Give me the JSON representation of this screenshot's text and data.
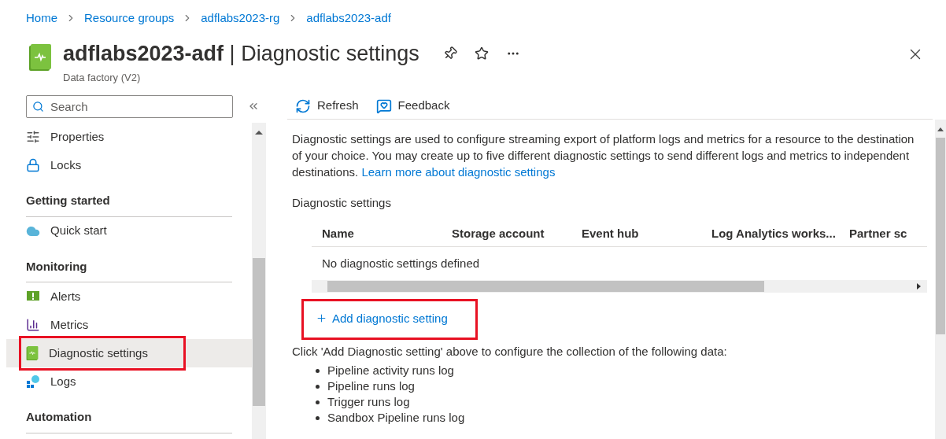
{
  "breadcrumb": [
    "Home",
    "Resource groups",
    "adflabs2023-rg",
    "adflabs2023-adf"
  ],
  "header": {
    "resource": "adflabs2023-adf",
    "separator": "|",
    "page": "Diagnostic settings",
    "subtitle": "Data factory (V2)"
  },
  "sidebar": {
    "search": {
      "placeholder": "Search"
    },
    "items": [
      {
        "kind": "item",
        "label": "Properties",
        "selected": false,
        "highlighted": false
      },
      {
        "kind": "item",
        "label": "Locks",
        "selected": false,
        "highlighted": false
      },
      {
        "kind": "heading",
        "label": "Getting started"
      },
      {
        "kind": "item",
        "label": "Quick start",
        "selected": false,
        "highlighted": false
      },
      {
        "kind": "heading",
        "label": "Monitoring"
      },
      {
        "kind": "item",
        "label": "Alerts",
        "selected": false,
        "highlighted": false
      },
      {
        "kind": "item",
        "label": "Metrics",
        "selected": false,
        "highlighted": false
      },
      {
        "kind": "item",
        "label": "Diagnostic settings",
        "selected": true,
        "highlighted": true
      },
      {
        "kind": "item",
        "label": "Logs",
        "selected": false,
        "highlighted": false
      },
      {
        "kind": "heading",
        "label": "Automation"
      }
    ]
  },
  "toolbar": [
    {
      "kind": "refresh",
      "label": "Refresh"
    },
    {
      "kind": "feedback",
      "label": "Feedback"
    }
  ],
  "description": {
    "text": "Diagnostic settings are used to configure streaming export of platform logs and metrics for a resource to the destination of your choice. You may create up to five different diagnostic settings to send different logs and metrics to independent destinations.",
    "link": "Learn more about diagnostic settings"
  },
  "section_title": "Diagnostic settings",
  "table": {
    "columns": [
      "Name",
      "Storage account",
      "Event hub",
      "Log Analytics works...",
      "Partner sc"
    ],
    "empty_message": "No diagnostic settings defined"
  },
  "add_button": {
    "label": "Add diagnostic setting",
    "highlighted": true
  },
  "instruction": "Click 'Add Diagnostic setting' above to configure the collection of the following data:",
  "data_list": [
    "Pipeline activity runs log",
    "Pipeline runs log",
    "Trigger runs log",
    "Sandbox Pipeline runs log"
  ]
}
